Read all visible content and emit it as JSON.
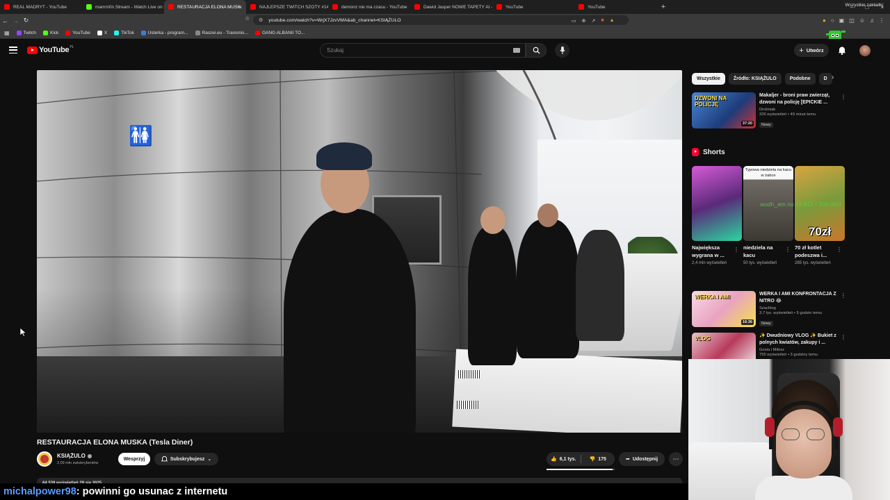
{
  "browser": {
    "tabs": [
      {
        "title": "REAL MADRYT - YouTube",
        "fav": "#ff0000",
        "active": false
      },
      {
        "title": "mamm0n Stream - Watch Live on Ki",
        "fav": "#53fc18",
        "active": false
      },
      {
        "title": "RESTAURACJA ELONA MUSK",
        "fav": "#ff0000",
        "active": true
      },
      {
        "title": "NAJLEPSZE TWITCH SZOTY #143",
        "fav": "#ff0000",
        "active": false
      },
      {
        "title": "demonz nie ma czasu - YouTube",
        "fav": "#ff0000",
        "active": false
      },
      {
        "title": "Dawid Jasper NOWE TAPETY AI - Yo",
        "fav": "#ff0000",
        "active": false
      },
      {
        "title": "YouTube",
        "fav": "#ff0000",
        "active": false
      },
      {
        "title": "YouTube",
        "fav": "#ff0000",
        "active": false
      }
    ],
    "url": "youtube.com/watch?v=WrjX7JzvVMA&ab_channel=KSIĄŻULO",
    "bookmarks": [
      {
        "label": "Twitch",
        "color": "#9146ff"
      },
      {
        "label": "Kick",
        "color": "#53fc18"
      },
      {
        "label": "YouTube",
        "color": "#ff0000"
      },
      {
        "label": "X",
        "color": "#ffffff"
      },
      {
        "label": "TikTok",
        "color": "#25f4ee"
      },
      {
        "label": "Usterka - program...",
        "color": "#3d7bd9"
      },
      {
        "label": "Raszei.eu - Transmis...",
        "color": "#888888"
      },
      {
        "label": "GANG ALBANII TO...",
        "color": "#ff0000"
      }
    ],
    "all_bookmarks": "Wszystkie zakładki"
  },
  "yt": {
    "logo": "YouTube",
    "logo_region": "PL",
    "search_placeholder": "Szukaj",
    "create_label": "Utwórz"
  },
  "video": {
    "title": "RESTAURACJA ELONA MUSKA (Tesla Diner)",
    "channel": "KSIĄŻULO",
    "subs": "2,09 mln subskrybentów",
    "support_label": "Wesprzyj",
    "subscribed_label": "Subskrybujesz",
    "likes": "6,1 tys.",
    "dislikes": "175",
    "like_ratio": 0.97,
    "share_label": "Udostępnij",
    "desc_peek": "64 539 wyświetleń  29 sie 2025"
  },
  "sidebar": {
    "chips": [
      "Wszystkie",
      "Źródło: KSIĄŻULO",
      "Podobne",
      "D"
    ],
    "recs": [
      {
        "title": "Makaljer - broni praw zwierząt, dzwoni na policję [EPICKIE ...",
        "channel": "Drobniak",
        "views": "326 wyświetleń • 49 minut temu",
        "badge": "Nowy",
        "duration": "37:20",
        "thumb_text": "DZWONI NA POLICJĘ"
      },
      {
        "title": "WERKA I AMI KONFRONTACJA Z NITRO 😂",
        "channel": "Szachlog",
        "views": "3,7 tys. wyświetleń • 5 godzin temu",
        "badge": "Nowy",
        "duration": "16:36",
        "thumb_text": "WERKA I AMI"
      },
      {
        "title": "✨ Dwudniowy VLOG ✨ Bukiet z polnych kwiatów, zakupy i ...",
        "channel": "Gosia i Miłosz",
        "views": "755 wyświetleń • 3 godziny temu",
        "badge": "",
        "duration": "",
        "thumb_text": "VLOG"
      }
    ],
    "shorts_label": "Shorts",
    "shorts": [
      {
        "title": "Największa wygrana w ...",
        "views": "2,4 mln wyświetleń",
        "overlay_top": "",
        "overlay_big": ""
      },
      {
        "title": "niedziela na kacu",
        "views": "50 tys. wyświetleń",
        "overlay_top": "Typowa niedziela na kacu w żabce",
        "overlay_big": ""
      },
      {
        "title": "70 zł kotlet podeszwa i...",
        "views": "285 tys. wyświetleń",
        "overlay_top": "",
        "overlay_big": "70zł"
      }
    ]
  },
  "overlay": {
    "green_text": "wudh_am no 19.812 / 200.00zł",
    "chat_user": "michalpower98",
    "chat_message": ": powinni go usunac z internetu"
  }
}
